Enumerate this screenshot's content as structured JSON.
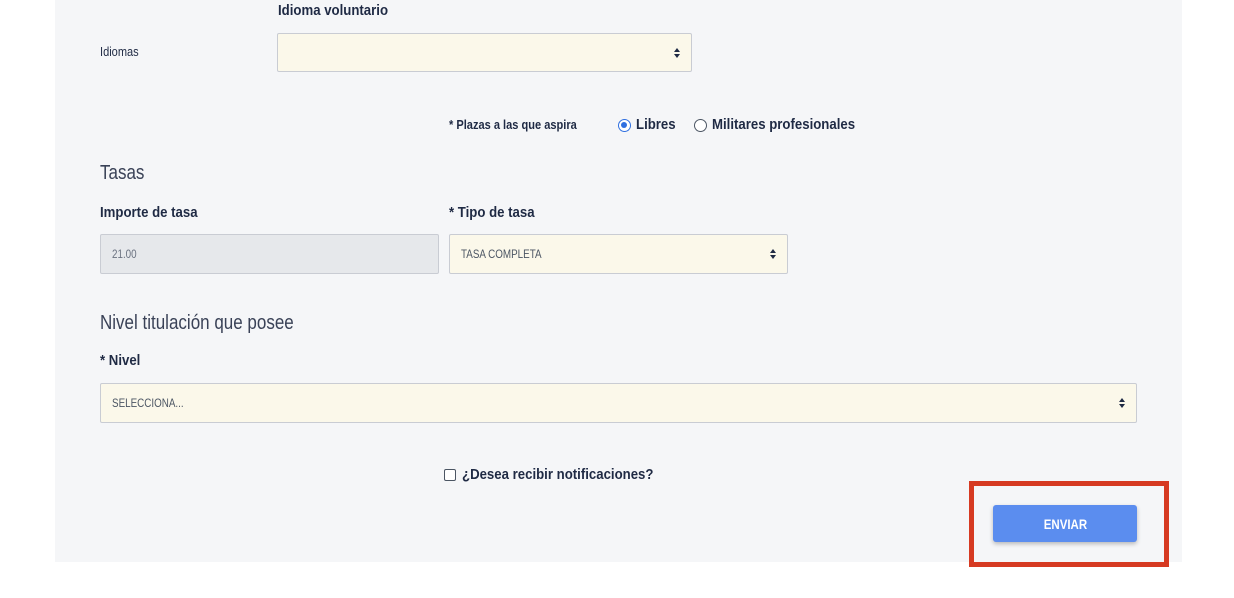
{
  "languages": {
    "section_heading": "Idioma voluntario",
    "field_label": "Idiomas",
    "selected_value": ""
  },
  "positions": {
    "label": "* Plazas a las que aspira",
    "options": [
      {
        "label": "Libres",
        "checked": true
      },
      {
        "label": "Militares profesionales",
        "checked": false
      }
    ]
  },
  "fees": {
    "section_title": "Tasas",
    "amount_label": "Importe de tasa",
    "amount_value": "21.00",
    "type_label": "* Tipo de tasa",
    "type_value": "TASA COMPLETA"
  },
  "education": {
    "section_title": "Nivel titulación que posee",
    "level_label": "* Nivel",
    "level_value": "SELECCIONA..."
  },
  "notifications": {
    "label": "¿Desea recibir notificaciones?",
    "checked": false
  },
  "actions": {
    "submit_label": "ENVIAR"
  },
  "colors": {
    "panel_background": "#f5f6f8",
    "select_background": "#fbf8ea",
    "readonly_background": "#e6e8eb",
    "button_primary": "#5b8def",
    "radio_accent": "#2f6fe0",
    "highlight_border": "#d63a22",
    "label_text": "#1f2a44"
  }
}
